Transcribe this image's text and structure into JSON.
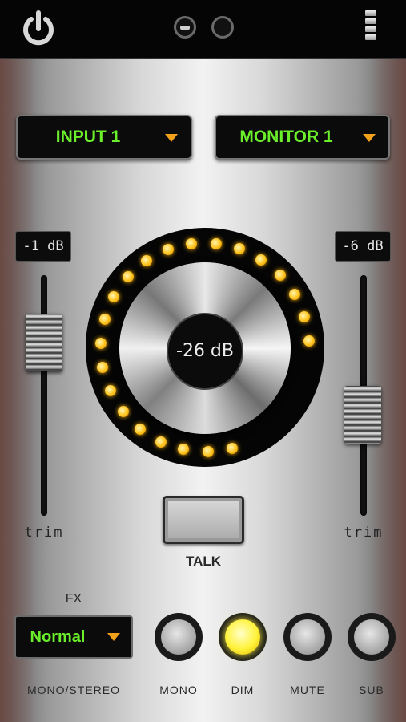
{
  "topbar": {
    "power_icon": "power-icon",
    "pages": [
      {
        "active": true
      },
      {
        "active": false
      }
    ],
    "menu_icon": "menu-icon"
  },
  "selectors": {
    "input": {
      "label": "INPUT 1"
    },
    "monitor": {
      "label": "MONITOR 1"
    }
  },
  "left_trim": {
    "value": "-1 dB",
    "label": "trim"
  },
  "right_trim": {
    "value": "-6 dB",
    "label": "trim"
  },
  "knob": {
    "value": "-26 dB"
  },
  "talk": {
    "label": "TALK"
  },
  "fx": {
    "title": "FX",
    "selected": "Normal",
    "caption": "MONO/STEREO"
  },
  "buttons": [
    {
      "label": "MONO",
      "lit": false
    },
    {
      "label": "DIM",
      "lit": true
    },
    {
      "label": "MUTE",
      "lit": false
    },
    {
      "label": "SUB",
      "lit": false
    }
  ],
  "colors": {
    "display_text": "#6cef2b",
    "caret": "#f2a11a",
    "led": "#ffc21a",
    "dim_lit": "#fff23a"
  }
}
